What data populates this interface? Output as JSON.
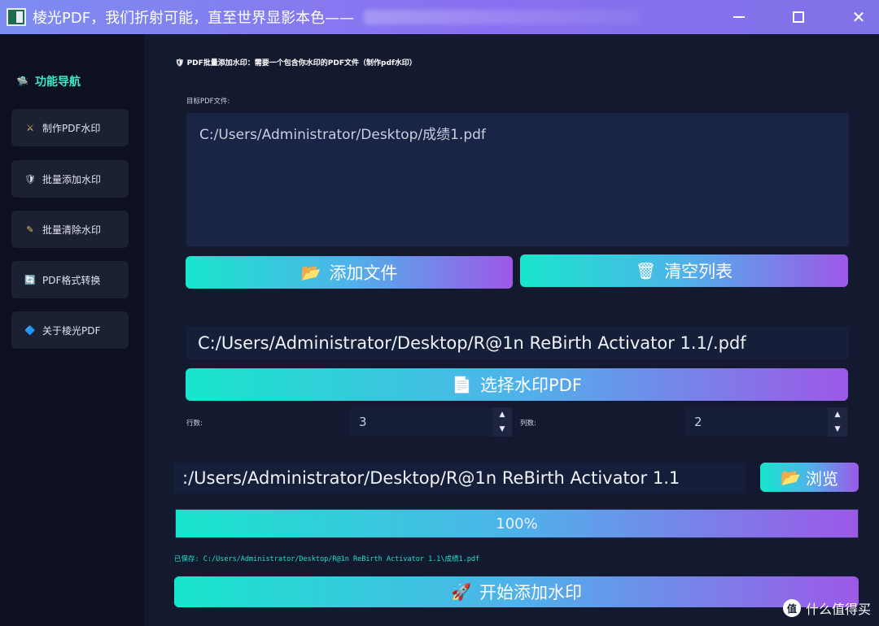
{
  "window": {
    "title": "棱光PDF，我们折射可能，直至世界显影本色——",
    "minimize": "—",
    "maximize": "☐",
    "close": "✕"
  },
  "sidebar": {
    "title": "功能导航",
    "title_icon": "ufo-icon",
    "items": [
      {
        "label": "制作PDF水印",
        "icon": "crossed-swords-icon",
        "glyph": "⚔"
      },
      {
        "label": "批量添加水印",
        "icon": "shield-icon",
        "glyph": "🛡"
      },
      {
        "label": "批量清除水印",
        "icon": "magic-wand-icon",
        "glyph": "✎"
      },
      {
        "label": "PDF格式转换",
        "icon": "refresh-icon",
        "glyph": "🔄"
      },
      {
        "label": "关于棱光PDF",
        "icon": "info-icon",
        "glyph": "🔷"
      }
    ]
  },
  "main": {
    "header_note": "PDF批量添加水印：需要一个包含你水印的PDF文件（制作pdf水印）",
    "target_label": "目标PDF文件:",
    "files": [
      "C:/Users/Administrator/Desktop/成绩1.pdf"
    ],
    "add_files_label": "添加文件",
    "clear_list_label": "清空列表",
    "watermark_path": "C:/Users/Administrator/Desktop/R@1n ReBirth Activator 1.1/.pdf",
    "choose_watermark_label": "选择水印PDF",
    "rows_label": "行数:",
    "rows_value": "3",
    "cols_label": "列数:",
    "cols_value": "2",
    "output_path": ":/Users/Administrator/Desktop/R@1n ReBirth Activator 1.1",
    "browse_label": "浏览",
    "progress_text": "100%",
    "progress_value": 1.0,
    "saved_note": "已保存: C:/Users/Administrator/Desktop/R@1n ReBirth Activator 1.1\\成绩1.pdf",
    "start_label": "开始添加水印"
  },
  "watermark_site": {
    "text": "什么值得买",
    "logo": "值"
  }
}
